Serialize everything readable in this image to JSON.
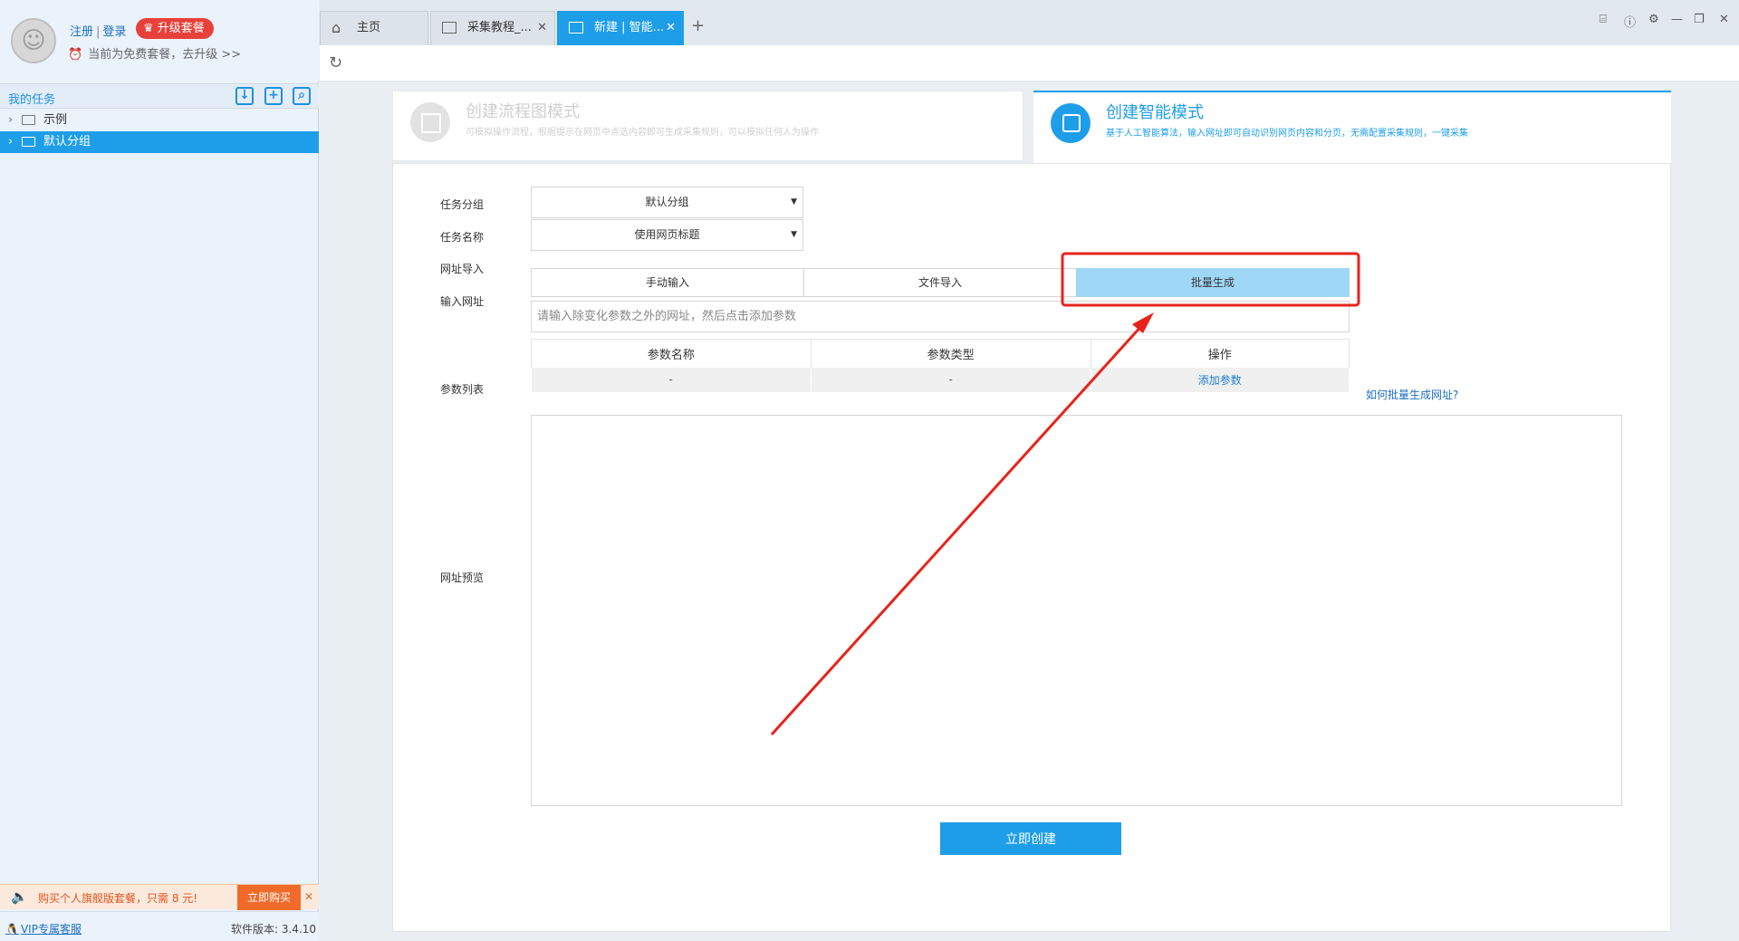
{
  "user": {
    "register": "注册",
    "login": "登录",
    "upgrade_badge": "升级套餐",
    "plan_notice": "当前为免费套餐，去升级 >>"
  },
  "sidebar": {
    "my_tasks": "我的任务",
    "items": [
      {
        "label": "示例",
        "active": false
      },
      {
        "label": "默认分组",
        "active": true
      }
    ],
    "promo_text": "购买个人旗舰版套餐，只需 8 元!",
    "promo_button": "立即购买",
    "vip_service": "VIP专属客服",
    "version": "软件版本: 3.4.10"
  },
  "tabs": [
    {
      "label": "主页",
      "icon": "home-icon",
      "active": false,
      "closable": false
    },
    {
      "label": "采集教程_...",
      "icon": "window-icon",
      "active": false,
      "closable": true
    },
    {
      "label": "新建 | 智能...",
      "icon": "window-icon",
      "active": true,
      "closable": true
    }
  ],
  "modes": {
    "flow": {
      "title": "创建流程图模式",
      "desc": "可模拟操作流程，根据提示在网页中点选内容即可生成采集规则，可以模拟任何人为操作"
    },
    "smart": {
      "title": "创建智能模式",
      "desc": "基于人工智能算法，输入网址即可自动识别网页内容和分页，无需配置采集规则，一键采集"
    }
  },
  "form": {
    "group_label": "任务分组",
    "group_value": "默认分组",
    "name_label": "任务名称",
    "name_value": "使用网页标题",
    "import_label": "网址导入",
    "import_options": [
      "手动输入",
      "文件导入",
      "批量生成"
    ],
    "import_active": "批量生成",
    "url_label": "输入网址",
    "url_placeholder": "请输入除变化参数之外的网址，然后点击添加参数",
    "params_label": "参数列表",
    "params_columns": [
      "参数名称",
      "参数类型",
      "操作"
    ],
    "params_row": [
      "-",
      "-",
      "添加参数"
    ],
    "help_link": "如何批量生成网址?",
    "preview_label": "网址预览",
    "submit": "立即创建"
  },
  "colors": {
    "accent": "#1e9ee9",
    "annotation": "#e8231b",
    "active_segment": "#9fd7f6"
  }
}
